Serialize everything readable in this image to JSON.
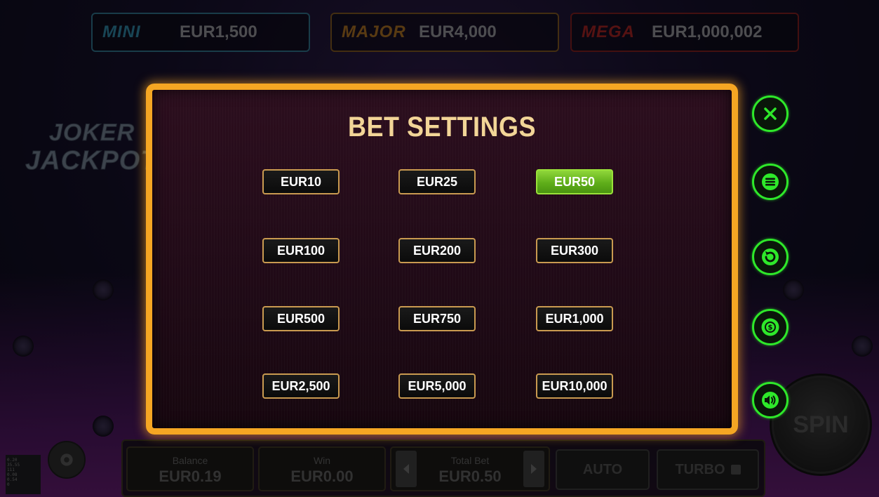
{
  "jackpots": [
    {
      "name": "MINI",
      "value": "EUR1,500",
      "color": "#3fa7c9"
    },
    {
      "name": "MAJOR",
      "value": "EUR4,000",
      "color": "#c8862a"
    },
    {
      "name": "MEGA",
      "value": "EUR1,000,002",
      "color": "#c22a2a"
    }
  ],
  "logo": {
    "line1": "JOKER",
    "line2": "JACKPOTS"
  },
  "modal": {
    "title": "BET SETTINGS",
    "bets": [
      {
        "label": "EUR10",
        "selected": false
      },
      {
        "label": "EUR25",
        "selected": false
      },
      {
        "label": "EUR50",
        "selected": true
      },
      {
        "label": "EUR100",
        "selected": false
      },
      {
        "label": "EUR200",
        "selected": false
      },
      {
        "label": "EUR300",
        "selected": false
      },
      {
        "label": "EUR500",
        "selected": false
      },
      {
        "label": "EUR750",
        "selected": false
      },
      {
        "label": "EUR1,000",
        "selected": false
      },
      {
        "label": "EUR2,500",
        "selected": false
      },
      {
        "label": "EUR5,000",
        "selected": false
      },
      {
        "label": "EUR10,000",
        "selected": false
      }
    ]
  },
  "side_icons": [
    "close-icon",
    "menu-icon",
    "history-icon",
    "coin-icon",
    "sound-icon"
  ],
  "accent_color": "#2ee82a",
  "spin": {
    "label": "SPIN"
  },
  "bottom": {
    "balance_label": "Balance",
    "balance_value": "EUR0.19",
    "win_label": "Win",
    "win_value": "EUR0.00",
    "total_bet_label": "Total Bet",
    "total_bet_value": "EUR0.50",
    "auto_label": "AUTO",
    "turbo_label": "TURBO"
  },
  "mini_stats": [
    "0.20",
    "35.55",
    "111",
    "0.08",
    "0.54",
    "0"
  ]
}
